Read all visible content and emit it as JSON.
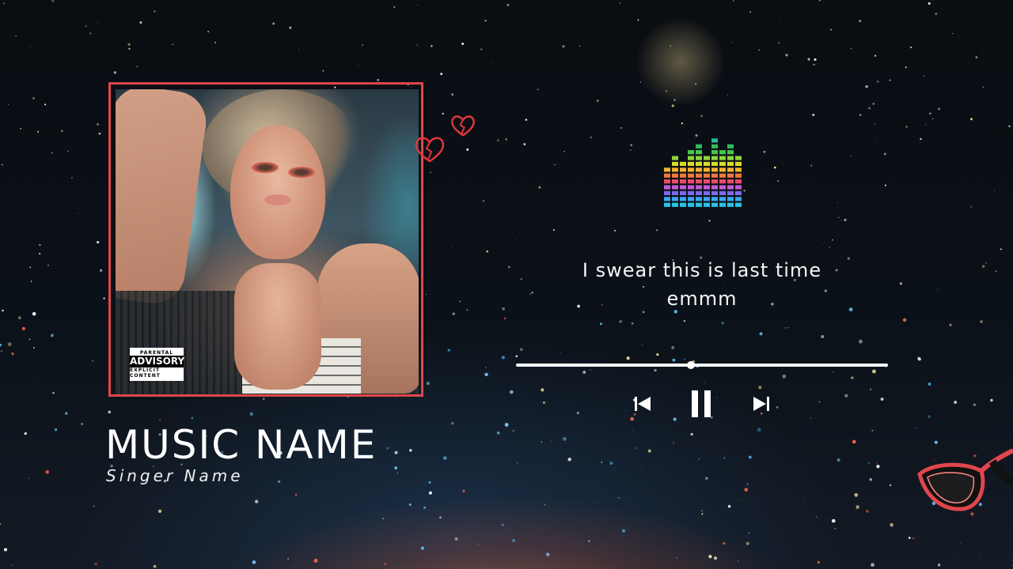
{
  "track": {
    "title": "MUSIC NAME",
    "artist": "Singer Name",
    "advisory": {
      "top": "PARENTAL",
      "middle": "ADVISORY",
      "bottom": "EXPLICIT CONTENT"
    }
  },
  "lyrics": {
    "line1": "I swear this is last time",
    "line2": "emmm"
  },
  "player": {
    "progress_fraction": 0.47,
    "state": "playing",
    "controls": [
      "previous",
      "pause",
      "next"
    ]
  },
  "colors": {
    "frame": "#e0474a",
    "text": "#ffffff"
  },
  "icons": {
    "heart": "broken-heart-icon",
    "equalizer": "equalizer-icon",
    "previous": "skip-previous-icon",
    "pause": "pause-icon",
    "next": "skip-next-icon",
    "glasses": "sunglasses-icon"
  }
}
